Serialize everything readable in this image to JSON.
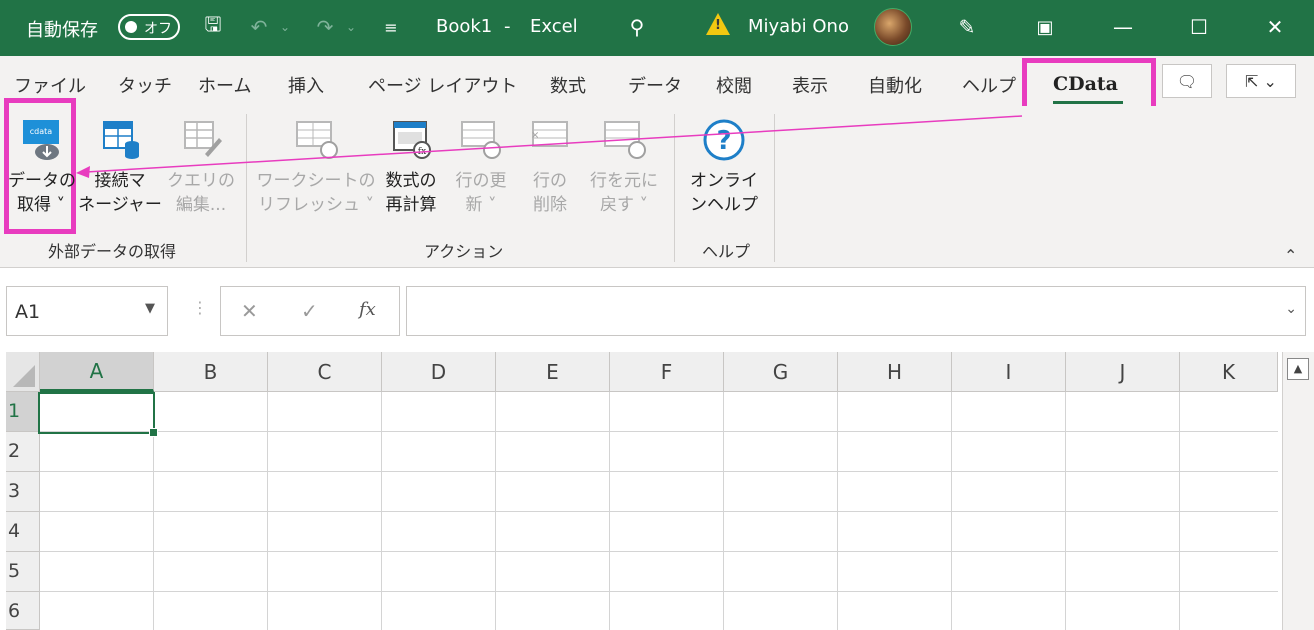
{
  "titlebar": {
    "autosave_label": "自動保存",
    "autosave_state": "オフ",
    "doc_title": "Book1",
    "app_sep": "-",
    "app_name": "Excel",
    "user_name": "Miyabi Ono"
  },
  "tabs": [
    "ファイル",
    "タッチ",
    "ホーム",
    "挿入",
    "ページ レイアウト",
    "数式",
    "データ",
    "校閲",
    "表示",
    "自動化",
    "ヘルプ"
  ],
  "active_tab": "CData",
  "ribbon": {
    "get_data": [
      "データの",
      "取得 ˅"
    ],
    "conn_mgr": [
      "接続マ",
      "ネージャー"
    ],
    "query_edit": [
      "クエリの",
      "編集..."
    ],
    "group_external": "外部データの取得",
    "refresh_ws": [
      "ワークシートの",
      "リフレッシュ ˅"
    ],
    "recalc": [
      "数式の",
      "再計算"
    ],
    "row_update": [
      "行の更",
      "新 ˅"
    ],
    "row_delete": [
      "行の",
      "削除"
    ],
    "row_restore": [
      "行を元に",
      "戻す ˅"
    ],
    "group_action": "アクション",
    "online_help": [
      "オンライ",
      "ンヘルプ"
    ],
    "group_help": "ヘルプ"
  },
  "formula_bar": {
    "name_box": "A1",
    "cancel_glyph": "✕",
    "enter_glyph": "✓",
    "fx_label": "fx",
    "formula_value": ""
  },
  "grid": {
    "columns": [
      "A",
      "B",
      "C",
      "D",
      "E",
      "F",
      "G",
      "H",
      "I",
      "J",
      "K"
    ],
    "rows": [
      "1",
      "2",
      "3",
      "4",
      "5",
      "6"
    ],
    "active_cell": "A1"
  },
  "colors": {
    "excel_green": "#217346",
    "highlight_magenta": "#e83cbf",
    "ribbon_bg": "#f3f2f1"
  }
}
